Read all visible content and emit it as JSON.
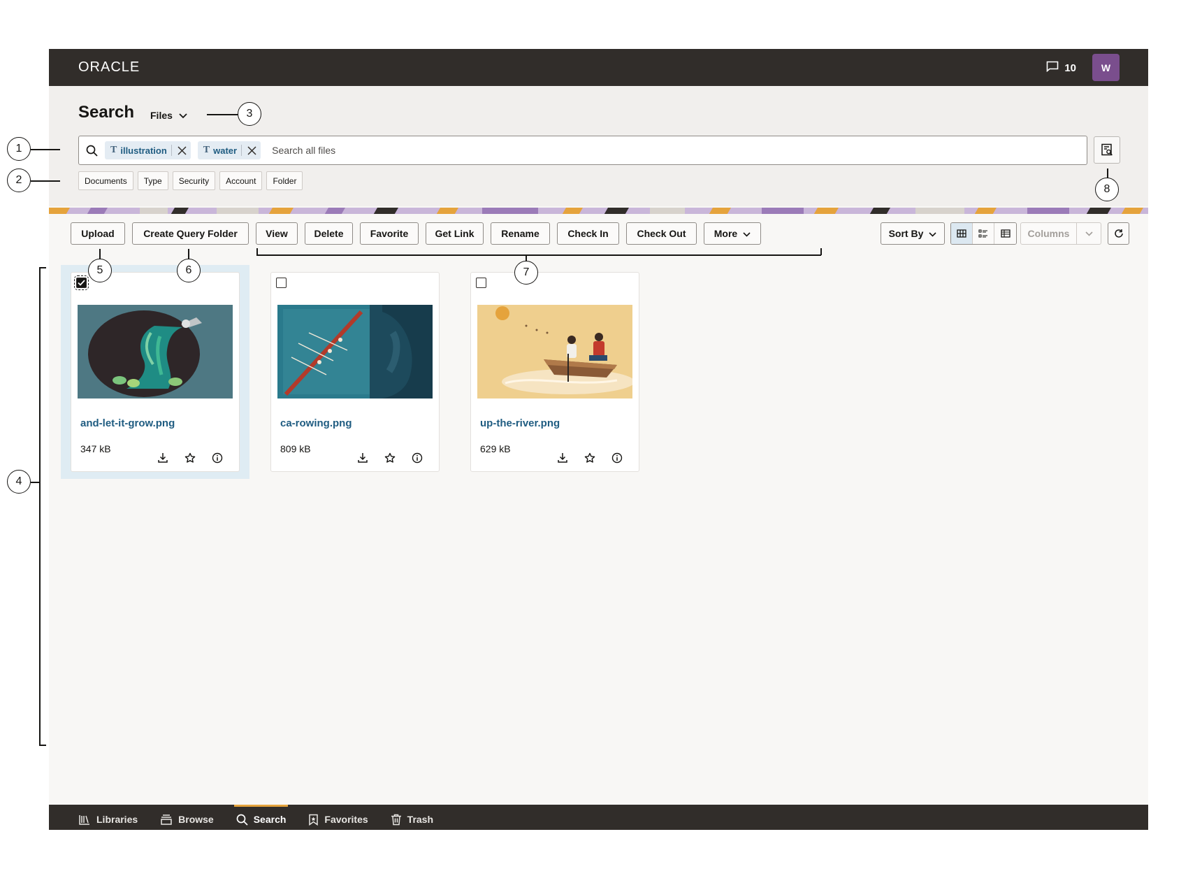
{
  "brand": {
    "logo_text": "ORACLE"
  },
  "topbar": {
    "notification_count": "10",
    "avatar_initial": "W"
  },
  "header": {
    "title": "Search",
    "scope_label": "Files",
    "search": {
      "chips": [
        {
          "type_glyph": "T",
          "label": "illustration"
        },
        {
          "type_glyph": "T",
          "label": "water"
        }
      ],
      "placeholder": "Search all files"
    },
    "filters": [
      "Documents",
      "Type",
      "Security",
      "Account",
      "Folder"
    ]
  },
  "toolbar": {
    "upload": "Upload",
    "create_query_folder": "Create Query Folder",
    "view": "View",
    "delete": "Delete",
    "favorite": "Favorite",
    "get_link": "Get Link",
    "rename": "Rename",
    "check_in": "Check In",
    "check_out": "Check Out",
    "more": "More",
    "sort_by": "Sort By",
    "columns": "Columns"
  },
  "files": [
    {
      "name": "and-let-it-grow.png",
      "size": "347 kB",
      "selected": true
    },
    {
      "name": "ca-rowing.png",
      "size": "809 kB",
      "selected": false
    },
    {
      "name": "up-the-river.png",
      "size": "629 kB",
      "selected": false
    }
  ],
  "bottom_nav": [
    {
      "label": "Libraries",
      "icon": "libraries-icon"
    },
    {
      "label": "Browse",
      "icon": "browse-icon"
    },
    {
      "label": "Search",
      "icon": "search-icon",
      "active": true
    },
    {
      "label": "Favorites",
      "icon": "bookmark-icon"
    },
    {
      "label": "Trash",
      "icon": "trash-icon"
    }
  ],
  "annotations": [
    "1",
    "2",
    "3",
    "4",
    "5",
    "6",
    "7",
    "8"
  ],
  "colors": {
    "topbar": "#312d2a",
    "link": "#1f5c81",
    "selection": "#dfecf3",
    "avatar": "#7a4e8d",
    "nav_accent": "#e5a33c"
  }
}
